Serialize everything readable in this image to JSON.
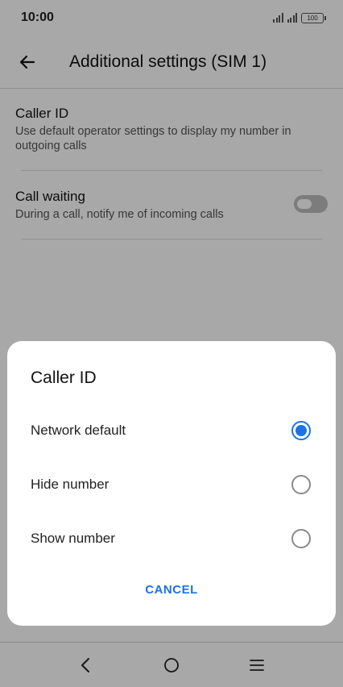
{
  "status_bar": {
    "time": "10:00",
    "battery": "100"
  },
  "app_bar": {
    "title": "Additional settings (SIM 1)"
  },
  "settings": [
    {
      "title": "Caller ID",
      "description": "Use default operator settings to display my number in outgoing calls"
    },
    {
      "title": "Call waiting",
      "description": "During a call, notify me of incoming calls",
      "toggle_on": false
    }
  ],
  "dialog": {
    "title": "Caller ID",
    "options": [
      {
        "label": "Network default",
        "selected": true
      },
      {
        "label": "Hide number",
        "selected": false
      },
      {
        "label": "Show number",
        "selected": false
      }
    ],
    "cancel_label": "CANCEL"
  },
  "colors": {
    "accent": "#1a73e8"
  }
}
